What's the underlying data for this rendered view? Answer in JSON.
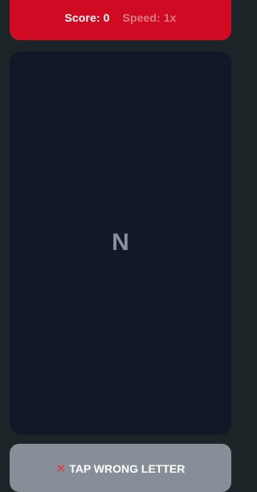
{
  "header": {
    "score_text": "Score: 0",
    "speed_text": "Speed: 1x",
    "background_color": "#d10a24"
  },
  "game": {
    "current_letter": "N"
  },
  "action_button": {
    "icon": "cross-mark-icon",
    "label": "TAP WRONG LETTER"
  }
}
